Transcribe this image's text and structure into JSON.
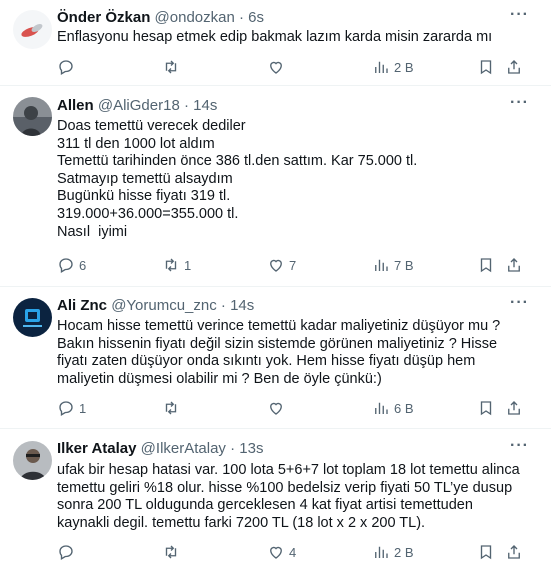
{
  "tweets": [
    {
      "name": "Önder Özkan",
      "handle": "@ondozkan",
      "dot": "·",
      "time": "6s",
      "text": "Enflasyonu hesap etmek edip bakmak lazım karda misin zararda mı",
      "replies": "",
      "retweets": "",
      "likes": "",
      "views": "2 B"
    },
    {
      "name": "Allen",
      "handle": "@AliGder18",
      "dot": "·",
      "time": "14s",
      "text": "Doas temettü verecek dediler\n311 tl den 1000 lot aldım\nTemettü tarihinden önce 386 tl.den sattım. Kar 75.000 tl.\nSatmayıp temettü alsaydım\nBugünkü hisse fiyatı 319 tl.\n319.000+36.000=355.000 tl.\nNasıl  iyimi",
      "replies": "6",
      "retweets": "1",
      "likes": "7",
      "views": "7 B"
    },
    {
      "name": "Ali Znc",
      "handle": "@Yorumcu_znc",
      "dot": "·",
      "time": "14s",
      "text": "Hocam hisse temettü verince temettü kadar maliyetiniz düşüyor mu ? Bakın hissenin fiyatı değil sizin sistemde görünen maliyetiniz ? Hisse fiyatı zaten düşüyor onda sıkıntı yok. Hem hisse fiyatı düşüp hem maliyetin düşmesi olabilir mi ? Ben de öyle çünkü:)",
      "replies": "1",
      "retweets": "",
      "likes": "",
      "views": "6 B"
    },
    {
      "name": "Ilker Atalay",
      "handle": "@IlkerAtalay",
      "dot": "·",
      "time": "13s",
      "text": "ufak bir hesap hatasi var. 100 lota 5+6+7 lot toplam 18 lot temettu alinca temettu geliri %18 olur. hisse %100 bedelsiz verip fiyati 50 TL’ye dusup sonra 200 TL oldugunda gerceklesen 4 kat fiyat artisi temettuden kaynakli degil. temettu farki 7200 TL (18 lot x 2 x 200 TL).",
      "replies": "",
      "retweets": "",
      "likes": "4",
      "views": "2 B"
    }
  ],
  "more_glyph": "···",
  "colors": {
    "text": "#0f1419",
    "secondary": "#536471",
    "divider": "#eff3f4"
  }
}
